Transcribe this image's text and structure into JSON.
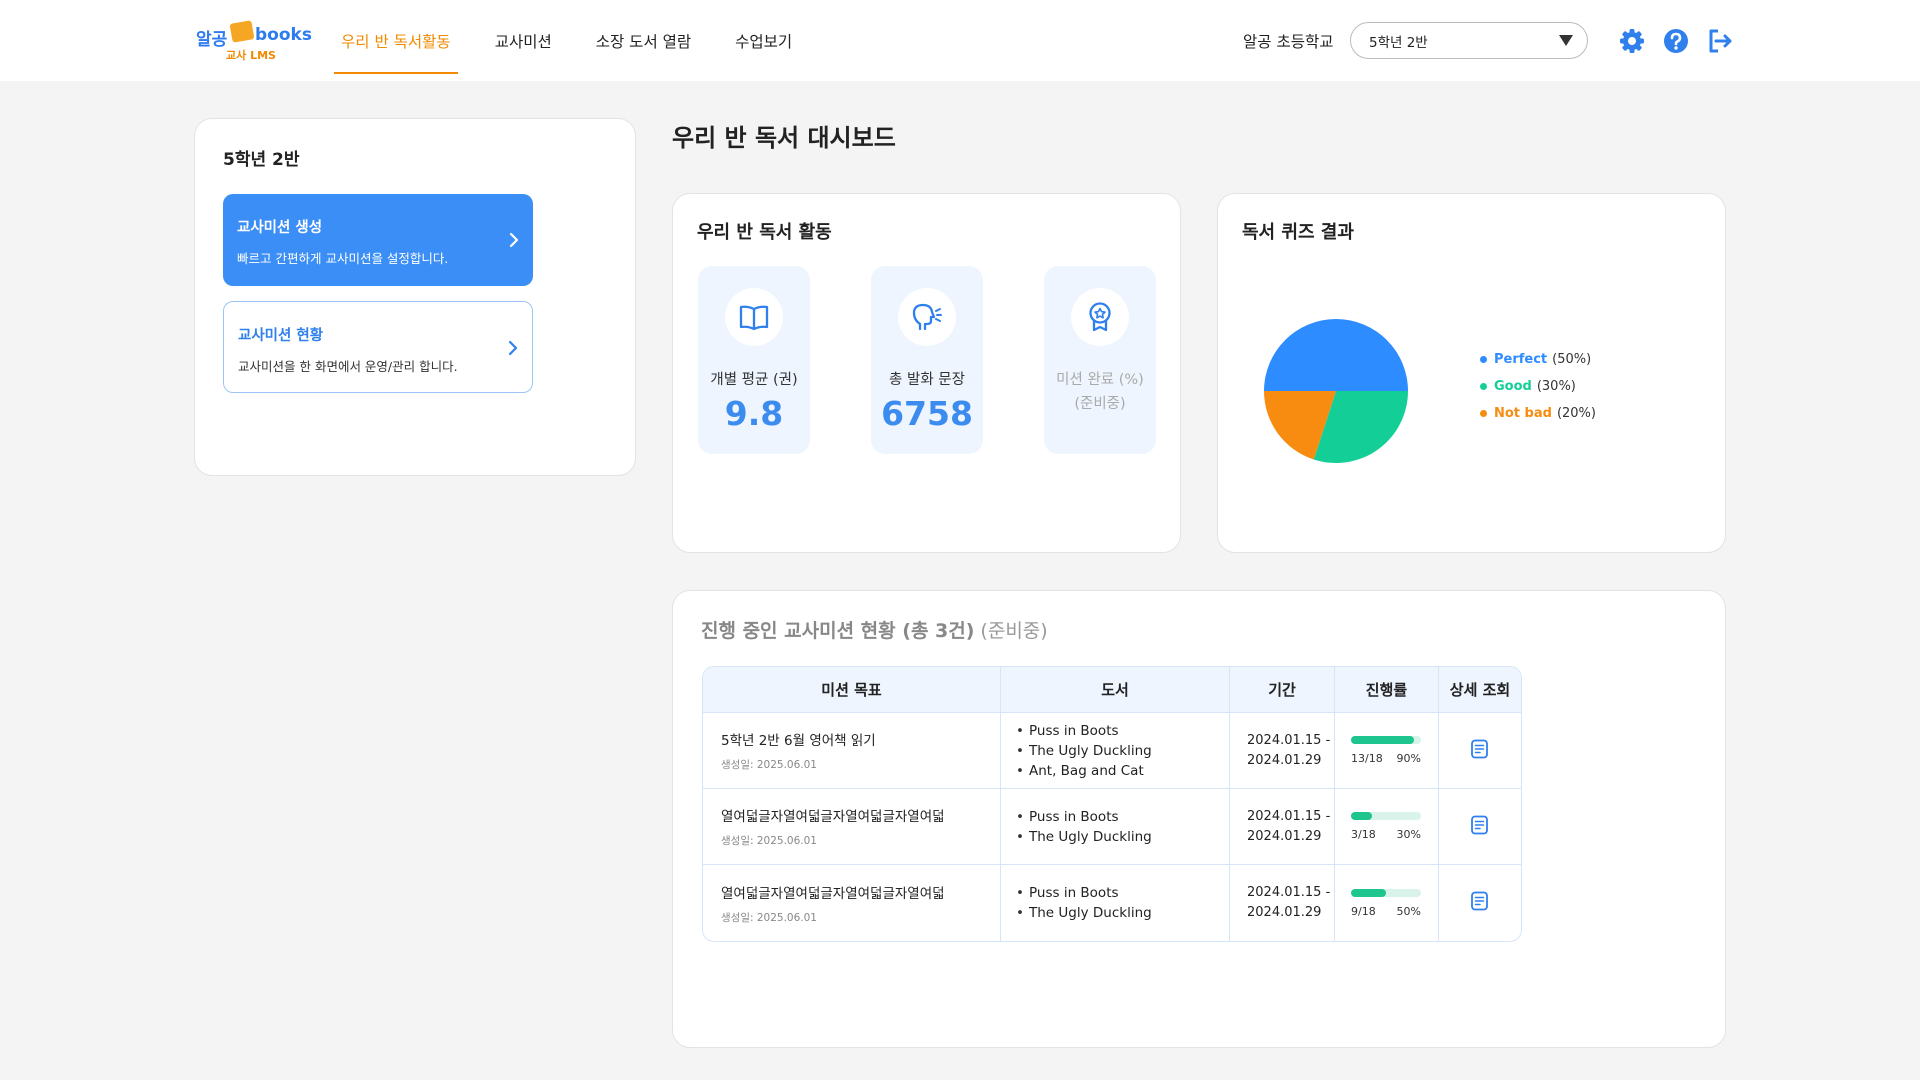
{
  "header": {
    "logo": {
      "brand_kr": "알공",
      "brand_en": "books",
      "sub": "교사 LMS"
    },
    "nav": [
      "우리 반 독서활동",
      "교사미션",
      "소장 도서 열람",
      "수업보기"
    ],
    "active_nav_index": 0,
    "school_name": "알공 초등학교",
    "class_select_value": "5학년 2반",
    "icons": [
      "gear-icon",
      "help-icon",
      "logout-icon"
    ]
  },
  "sidebar": {
    "title": "5학년 2반",
    "create": {
      "title": "교사미션 생성",
      "desc": "빠르고 간편하게 교사미션을 설정합니다."
    },
    "status": {
      "title": "교사미션 현황",
      "desc": "교사미션을 한 화면에서 운영/관리 합니다."
    }
  },
  "page_title": "우리 반 독서 대시보드",
  "activity": {
    "title": "우리 반 독서 활동",
    "stats": [
      {
        "icon": "book-icon",
        "label": "개별 평균 (권)",
        "value": "9.8"
      },
      {
        "icon": "speaking-head-icon",
        "label": "총 발화 문장",
        "value": "6758"
      },
      {
        "icon": "award-badge-icon",
        "label": "미션 완료 (%)",
        "sub": "(준비중)",
        "value": ""
      }
    ]
  },
  "quiz": {
    "title": "독서 퀴즈 결과",
    "legend": [
      {
        "name": "Perfect",
        "pct": "(50%)",
        "color": "#2d8cff"
      },
      {
        "name": "Good",
        "pct": "(30%)",
        "color": "#13cf97"
      },
      {
        "name": "Not bad",
        "pct": "(20%)",
        "color": "#f78c10"
      }
    ]
  },
  "chart_data": {
    "type": "pie",
    "categories": [
      "Perfect",
      "Good",
      "Not bad"
    ],
    "values": [
      50,
      30,
      20
    ],
    "colors": [
      "#2d8cff",
      "#13cf97",
      "#f78c10"
    ]
  },
  "missions": {
    "title": "진행 중인 교사미션 현황 (총 3건)",
    "title_sub": "(준비중)",
    "headers": [
      "미션 목표",
      "도서",
      "기간",
      "진행률",
      "상세 조회"
    ],
    "rows": [
      {
        "goal": "5학년 2반 6월 영어책 읽기",
        "created": "생성일: 2025.06.01",
        "books": [
          "Puss in Boots",
          "The Ugly Duckling",
          "Ant, Bag and Cat"
        ],
        "period_start": "2024.01.15 -",
        "period_end": "2024.01.29",
        "count": "13/18",
        "percent": "90%",
        "progress": 0.9
      },
      {
        "goal": "열여덟글자열여덟글자열여덟글자열여덟",
        "created": "생성일: 2025.06.01",
        "books": [
          "Puss in Boots",
          "The Ugly Duckling"
        ],
        "period_start": "2024.01.15 -",
        "period_end": "2024.01.29",
        "count": "3/18",
        "percent": "30%",
        "progress": 0.3
      },
      {
        "goal": "열여덟글자열여덟글자열여덟글자열여덟",
        "created": "생성일: 2025.06.01",
        "books": [
          "Puss in Boots",
          "The Ugly Duckling"
        ],
        "period_start": "2024.01.15 -",
        "period_end": "2024.01.29",
        "count": "9/18",
        "percent": "50%",
        "progress": 0.5
      }
    ]
  }
}
